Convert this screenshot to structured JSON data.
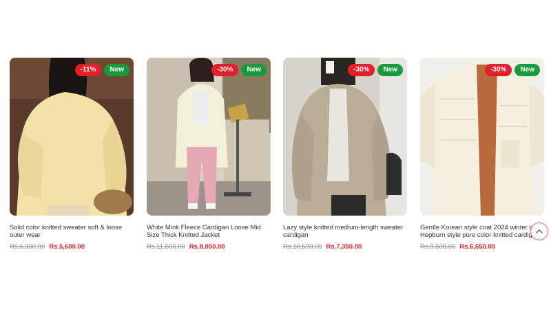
{
  "products": [
    {
      "title": "Solid color knitted sweater soft & loose outer wear",
      "old_price": "Rs.6,300.00",
      "price": "Rs.5,600.00",
      "discount_badge": "-11%",
      "new_badge": "New"
    },
    {
      "title": "White Mink Fleece Cardigan Loose Mid Size Thick Knitted Jacket",
      "old_price": "Rs.11,500.00",
      "price": "Rs.8,050.00",
      "discount_badge": "-30%",
      "new_badge": "New"
    },
    {
      "title": "Lazy style knitted medium-length sweater cardigan",
      "old_price": "Rs.10,500.00",
      "price": "Rs.7,350.00",
      "discount_badge": "-30%",
      "new_badge": "New"
    },
    {
      "title": "Gentle Korean style coat 2024 winter new Hepburn style pure color knitted cardigan",
      "old_price": "Rs.9,500.00",
      "price": "Rs.6,650.00",
      "discount_badge": "-30%",
      "new_badge": "New"
    }
  ],
  "colors": {
    "sale_badge": "#e3202a",
    "new_badge": "#1a9a3c",
    "price": "#e3202a",
    "old_price": "#8a8a8a"
  },
  "icons": {
    "back_to_top": "chevron-up-icon"
  }
}
